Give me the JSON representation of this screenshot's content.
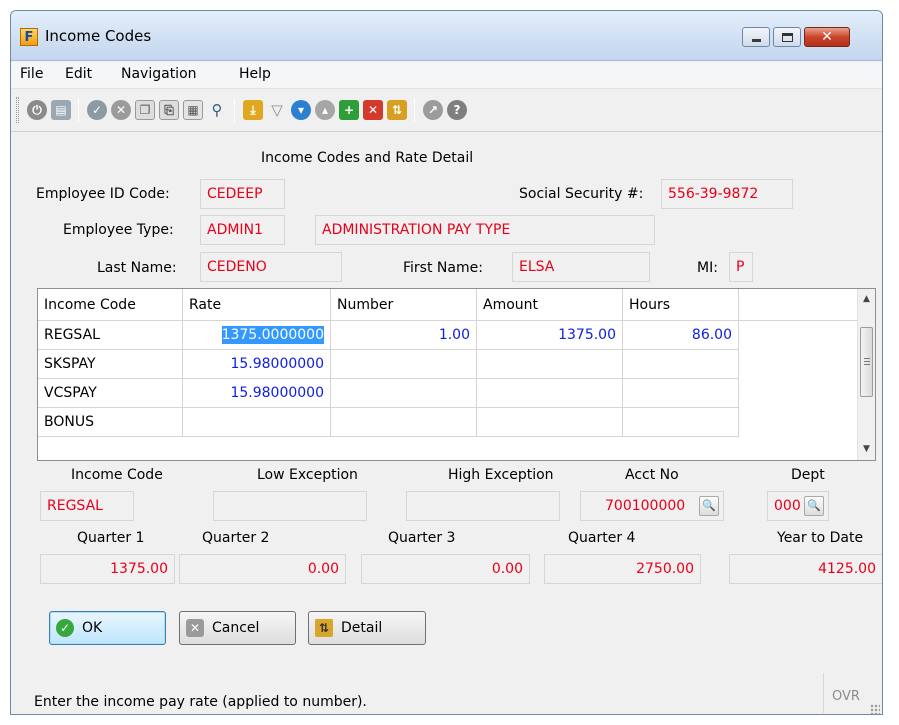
{
  "window": {
    "title": "Income Codes"
  },
  "menu": [
    "File",
    "Edit",
    "Navigation",
    "Help"
  ],
  "toolbar_icons": [
    "power-icon",
    "save-icon",
    "check-icon",
    "cancel-x-icon",
    "copy-icon",
    "paste-icon",
    "document-icon",
    "zoom-icon",
    "download-icon",
    "filter-icon",
    "move-down-icon",
    "move-up-icon",
    "add-record-icon",
    "delete-record-icon",
    "sort-icon",
    "chart-icon",
    "help-icon"
  ],
  "form": {
    "heading": "Income Codes and Rate Detail",
    "employee_id_label": "Employee ID Code:",
    "employee_id": "CEDEEP",
    "ssn_label": "Social Security #:",
    "ssn": "556-39-9872",
    "employee_type_label": "Employee Type:",
    "employee_type": "ADMIN1",
    "employee_type_desc": "ADMINISTRATION PAY TYPE",
    "last_name_label": "Last Name:",
    "last_name": "CEDENO",
    "first_name_label": "First Name:",
    "first_name": "ELSA",
    "mi_label": "MI:",
    "mi": "P"
  },
  "grid": {
    "columns": [
      "Income Code",
      "Rate",
      "Number",
      "Amount",
      "Hours"
    ],
    "rows": [
      {
        "code": "REGSAL",
        "rate": "1375.0000000",
        "number": "1.00",
        "amount": "1375.00",
        "hours": "86.00"
      },
      {
        "code": "SKSPAY",
        "rate": "15.98000000",
        "number": "",
        "amount": "",
        "hours": ""
      },
      {
        "code": "VCSPAY",
        "rate": "15.98000000",
        "number": "",
        "amount": "",
        "hours": ""
      },
      {
        "code": "BONUS",
        "rate": "",
        "number": "",
        "amount": "",
        "hours": ""
      }
    ]
  },
  "detail": {
    "income_code_label": "Income Code",
    "income_code": "REGSAL",
    "low_exception_label": "Low Exception",
    "low_exception": "",
    "high_exception_label": "High Exception",
    "high_exception": "",
    "acct_no_label": "Acct No",
    "acct_no": "700100000",
    "dept_label": "Dept",
    "dept": "000"
  },
  "quarters": {
    "q1_label": "Quarter 1",
    "q1": "1375.00",
    "q2_label": "Quarter 2",
    "q2": "0.00",
    "q3_label": "Quarter 3",
    "q3": "0.00",
    "q4_label": "Quarter 4",
    "q4": "2750.00",
    "ytd_label": "Year to Date",
    "ytd": "4125.00"
  },
  "buttons": {
    "ok": "OK",
    "cancel": "Cancel",
    "detail": "Detail"
  },
  "status": {
    "text": "Enter the income pay rate (applied to number).",
    "mode": "OVR"
  },
  "colors": {
    "field_text": "#e8001a",
    "grid_number": "#1020e0",
    "selection": "#3399ff"
  }
}
